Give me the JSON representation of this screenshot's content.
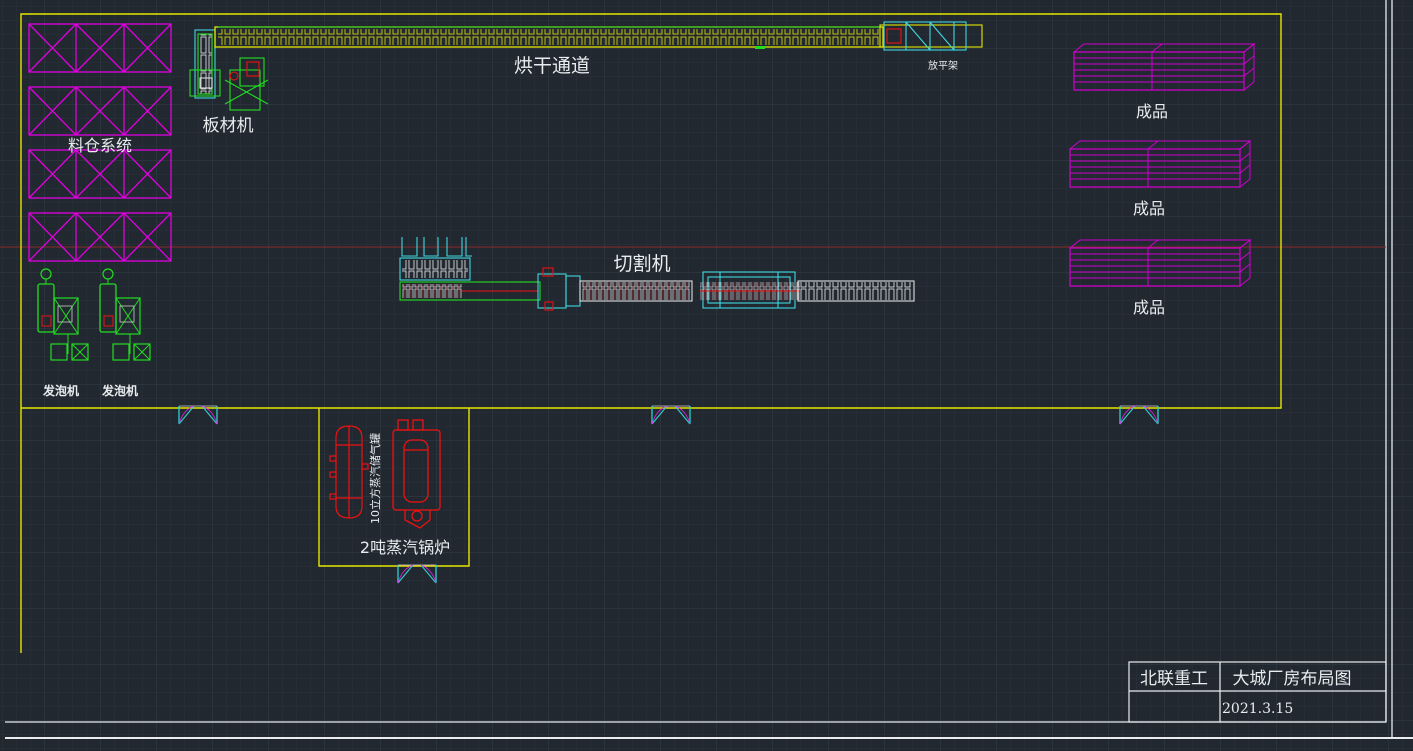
{
  "labels": {
    "drying_tunnel": "烘干通道",
    "leveling_rack": "放平架",
    "board_machine": "板材机",
    "silo_system": "料仓系统",
    "foaming_machine_1": "发泡机",
    "foaming_machine_2": "发泡机",
    "cutting_machine": "切割机",
    "finished_1": "成品",
    "finished_2": "成品",
    "finished_3": "成品",
    "steam_tank": "10立方蒸汽储气罐",
    "boiler": "2吨蒸汽锅炉"
  },
  "title_block": {
    "company": "北联重工",
    "drawing_title": "大城厂房布局图",
    "date": "2021.3.15"
  },
  "colors": {
    "wall": "#e6e600",
    "silo": "#e000e0",
    "finished": "#d000d0",
    "equipment_green": "#22dd22",
    "equipment_cyan": "#40d8e0",
    "equipment_red": "#ee1111",
    "door": "#30d0d0",
    "border": "#e8ecef",
    "axis_line": "#8a2a2a"
  }
}
